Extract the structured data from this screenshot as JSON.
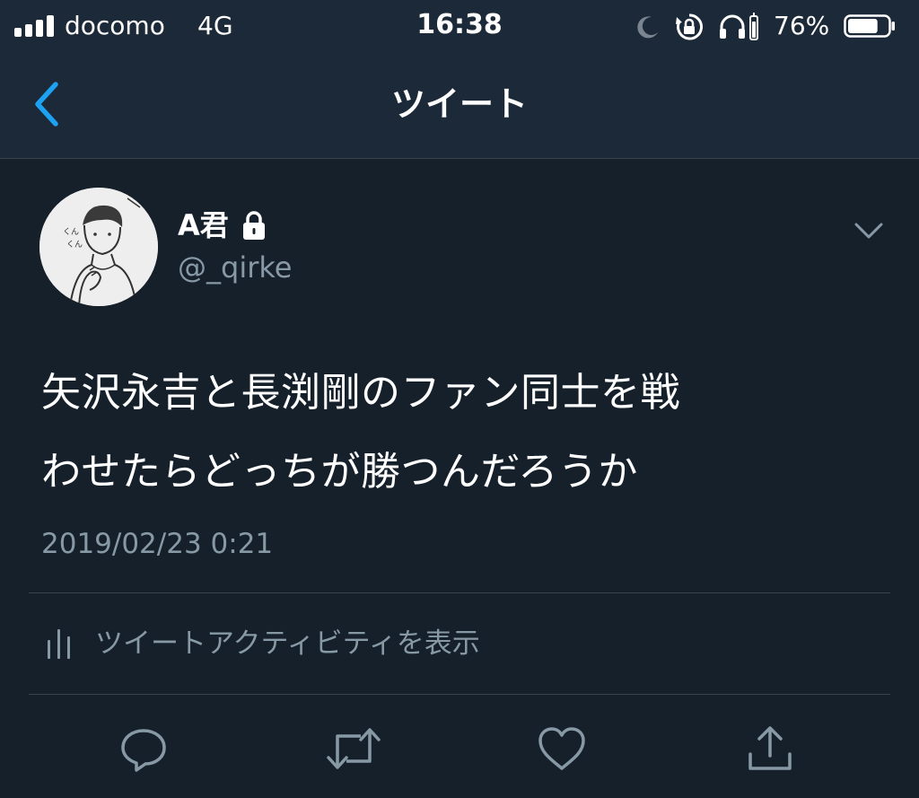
{
  "status_bar": {
    "carrier": "docomo",
    "network": "4G",
    "time": "16:38",
    "battery_percent": "76%",
    "battery_level": 0.76,
    "icons": [
      "signal-icon",
      "moon-icon",
      "rotation-lock-icon",
      "headphones-icon",
      "battery-icon"
    ]
  },
  "nav": {
    "title": "ツイート",
    "back_icon": "chevron-left-icon"
  },
  "tweet": {
    "display_name": "A君",
    "handle": "@_qirke",
    "protected": true,
    "text_lines": [
      "矢沢永吉と長渕剛のファン同士を戦",
      "わせたらどっちが勝つんだろうか"
    ],
    "timestamp": "2019/02/23 0:21",
    "activity_label": "ツイートアクティビティを表示"
  },
  "actions": [
    "reply-icon",
    "retweet-icon",
    "like-icon",
    "share-icon"
  ],
  "colors": {
    "background": "#15202b",
    "header": "#1c2938",
    "accent": "#1da1f2",
    "secondary_text": "#8899a6",
    "divider": "#38444d"
  }
}
